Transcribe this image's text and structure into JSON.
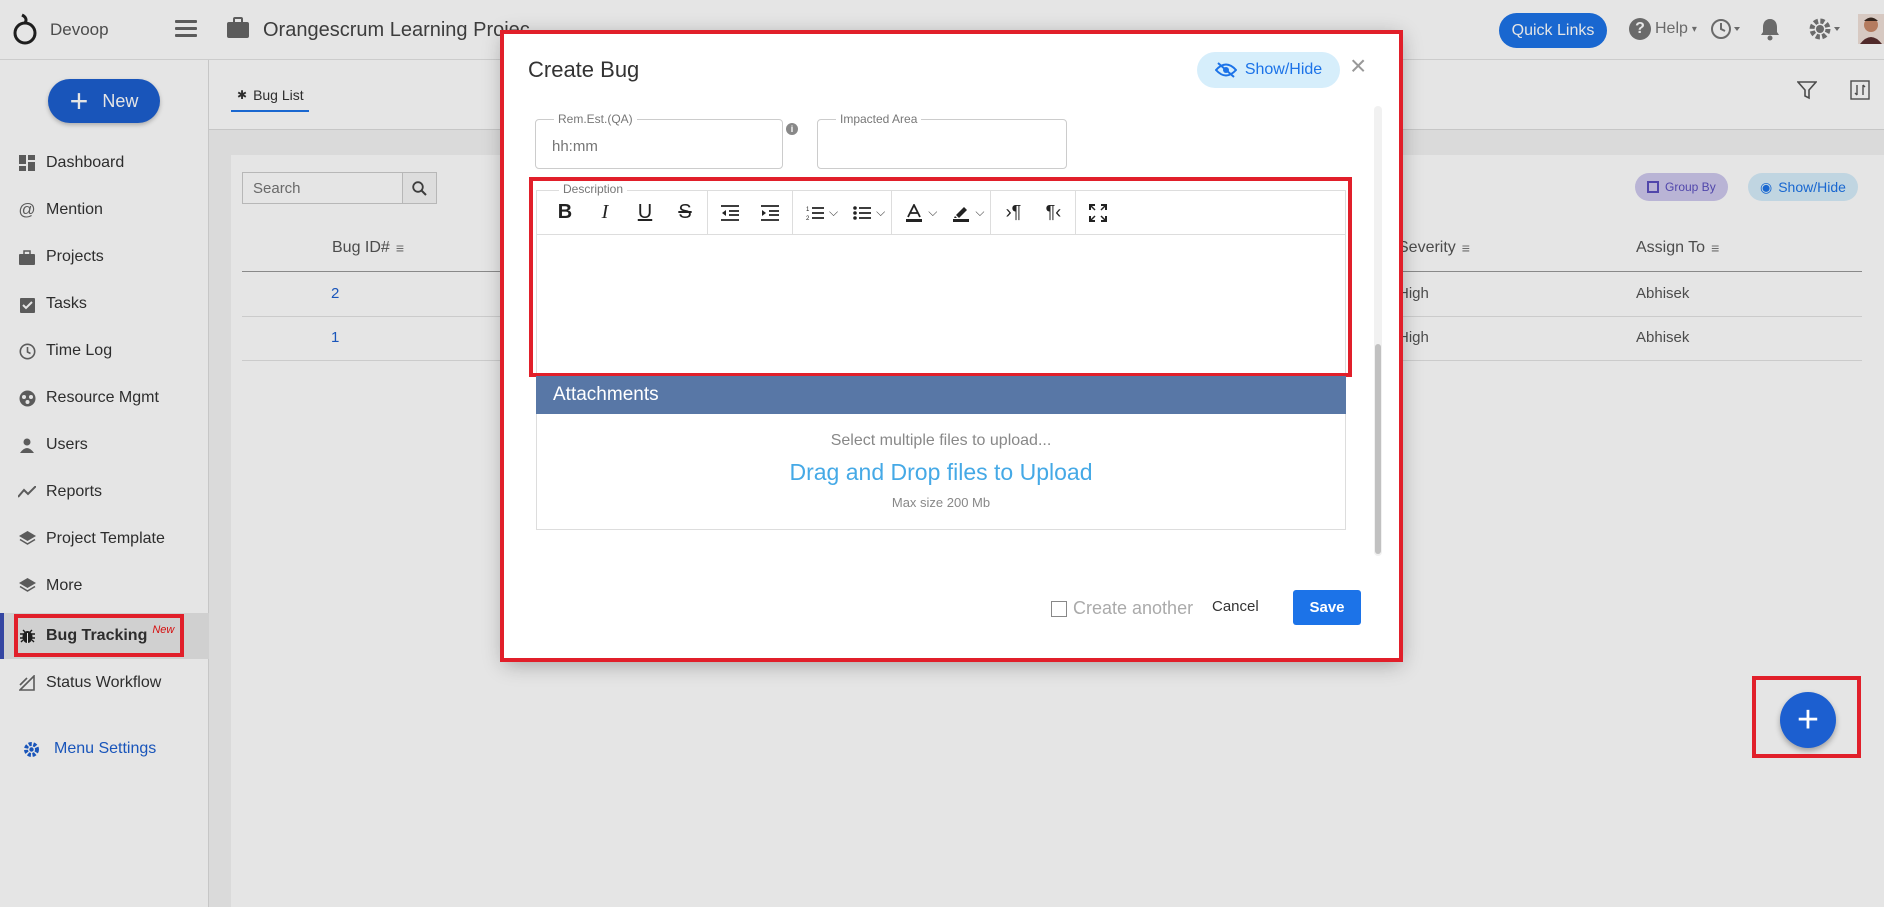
{
  "app": {
    "org_name": "Devoop",
    "project_title": "Orangescrum Learning Projec"
  },
  "header": {
    "quick_links": "Quick Links",
    "help": "Help"
  },
  "sidebar": {
    "new_label": "New",
    "items": [
      {
        "label": "Dashboard",
        "icon": "dashboard-icon"
      },
      {
        "label": "Mention",
        "icon": "at-icon"
      },
      {
        "label": "Projects",
        "icon": "briefcase-icon"
      },
      {
        "label": "Tasks",
        "icon": "clipboard-check-icon"
      },
      {
        "label": "Time Log",
        "icon": "clock-icon"
      },
      {
        "label": "Resource Mgmt",
        "icon": "resource-icon"
      },
      {
        "label": "Users",
        "icon": "user-icon"
      },
      {
        "label": "Reports",
        "icon": "trend-icon"
      },
      {
        "label": "Project Template",
        "icon": "layers-icon"
      },
      {
        "label": "More",
        "icon": "layers-icon"
      },
      {
        "label": "Bug Tracking",
        "icon": "bug-icon",
        "badge": "New"
      },
      {
        "label": "Status Workflow",
        "icon": "workflow-icon"
      }
    ],
    "menu_settings": "Menu Settings"
  },
  "main": {
    "tab_label": "Bug List",
    "search_placeholder": "Search",
    "group_by": "Group By",
    "show_hide": "Show/Hide",
    "columns": [
      "Bug ID#",
      "Severity",
      "Assign To"
    ],
    "rows": [
      {
        "id": "2",
        "severity": "High",
        "assignee": "Abhisek"
      },
      {
        "id": "1",
        "severity": "High",
        "assignee": "Abhisek"
      }
    ]
  },
  "modal": {
    "title": "Create Bug",
    "show_hide": "Show/Hide",
    "rem_est_label": "Rem.Est.(QA)",
    "rem_est_placeholder": "hh:mm",
    "impacted_area_label": "Impacted Area",
    "description_label": "Description",
    "attachments": {
      "title": "Attachments",
      "hint": "Select multiple files to upload...",
      "drop": "Drag and Drop files to Upload",
      "max": "Max size 200 Mb"
    },
    "create_another": "Create another",
    "cancel": "Cancel",
    "save": "Save"
  },
  "colors": {
    "accent": "#1c73e8",
    "highlight": "#e11f2a",
    "attachments_header": "#5877a6"
  }
}
